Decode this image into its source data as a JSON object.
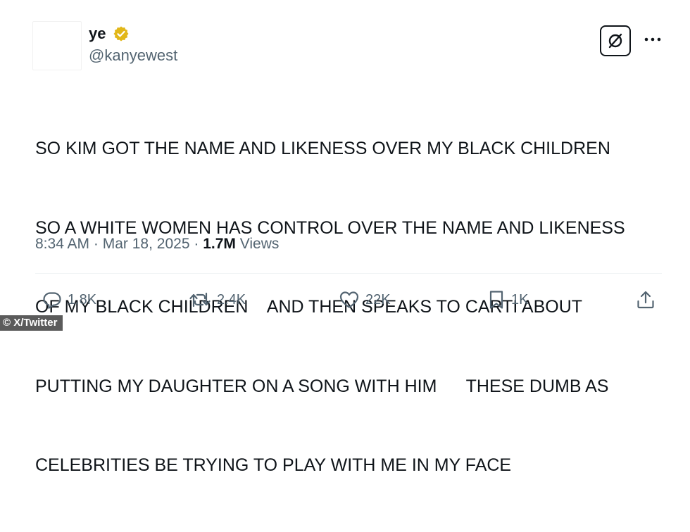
{
  "post": {
    "display_name": "ye",
    "handle": "@kanyewest",
    "text_lines": [
      "SO KIM GOT THE NAME AND LIKENESS OVER MY BLACK CHILDREN",
      "SO A WHITE WOMEN HAS CONTROL OVER THE NAME AND LIKENESS",
      "OF MY BLACK CHILDREN    AND THEN SPEAKS TO CARTI ABOUT",
      "PUTTING MY DAUGHTER ON A SONG WITH HIM      THESE DUMB AS",
      "CELEBRITIES BE TRYING TO PLAY WITH ME IN MY FACE"
    ],
    "time": "8:34 AM",
    "date": "Mar 18, 2025",
    "views_count": "1.7M",
    "views_label": "Views",
    "separator": "·"
  },
  "actions": {
    "replies": "1.8K",
    "reposts": "2.4K",
    "likes": "22K",
    "bookmarks": "1K"
  },
  "icons": {
    "verified": "verified-badge-icon",
    "grok": "grok-icon",
    "more": "more-icon",
    "reply": "reply-icon",
    "repost": "repost-icon",
    "like": "like-icon",
    "bookmark": "bookmark-icon",
    "share": "share-icon"
  },
  "colors": {
    "text": "#0f1419",
    "secondary": "#536471",
    "verified_gold": "#e2b719",
    "divider": "#eff3f4"
  },
  "credit": "© X/Twitter"
}
